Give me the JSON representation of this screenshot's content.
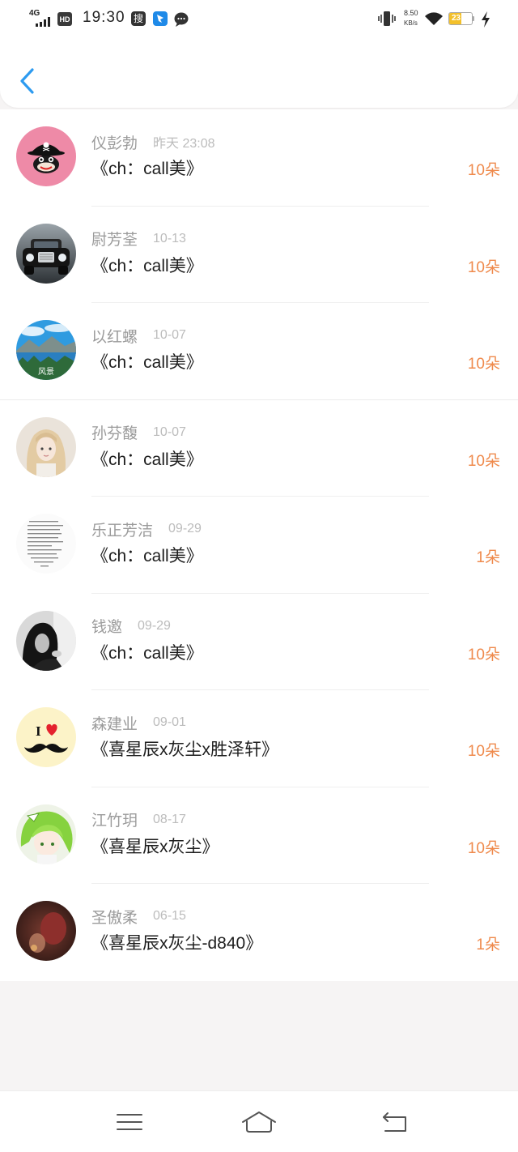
{
  "status_bar": {
    "network_type": "4G",
    "hd_label": "HD",
    "time": "19:30",
    "app_badge_label": "搜",
    "net_speed_value": "8.50",
    "net_speed_unit": "KB/s",
    "battery_level": "23",
    "left_icons": [
      "signal-icon",
      "hd-icon",
      "search-app-icon",
      "blue-app-icon",
      "chat-bubble-icon"
    ],
    "right_icons": [
      "vibrate-icon",
      "wifi-icon",
      "battery-icon",
      "charging-bolt-icon"
    ]
  },
  "header": {
    "back_icon": "chevron-left-icon"
  },
  "theme": {
    "accent": "#2d9bf0",
    "count_color": "#ef8a4c",
    "name_color": "#9b9b9b",
    "time_color": "#bcbcbc",
    "title_color": "#1e1e1e",
    "page_bg": "#f6f4f4"
  },
  "list": {
    "items": [
      {
        "avatar": "pirate-monkey-avatar",
        "name": "仪彭勃",
        "time": "昨天 23:08",
        "title": "《ch：call美》",
        "count": "10朵"
      },
      {
        "avatar": "car-avatar",
        "name": "尉芳荃",
        "time": "10-13",
        "title": "《ch：call美》",
        "count": "10朵"
      },
      {
        "avatar": "landscape-avatar",
        "avatar_text": "风景",
        "name": "以红螺",
        "time": "10-07",
        "title": "《ch：call美》",
        "count": "10朵"
      },
      {
        "avatar": "blonde-girl-avatar",
        "name": "孙芬馥",
        "time": "10-07",
        "title": "《ch：call美》",
        "count": "10朵"
      },
      {
        "avatar": "text-note-avatar",
        "name": "乐正芳洁",
        "time": "09-29",
        "title": "《ch：call美》",
        "count": "1朵"
      },
      {
        "avatar": "bw-girl-avatar",
        "name": "钱邀",
        "time": "09-29",
        "title": "《ch：call美》",
        "count": "10朵"
      },
      {
        "avatar": "mustache-avatar",
        "avatar_text": "I",
        "name": "森建业",
        "time": "09-01",
        "title": "《喜星辰x灰尘x胜泽轩》",
        "count": "10朵"
      },
      {
        "avatar": "green-hair-anime-avatar",
        "name": "江竹玥",
        "time": "08-17",
        "title": "《喜星辰x灰尘》",
        "count": "10朵"
      },
      {
        "avatar": "dark-red-photo-avatar",
        "name": "圣傲柔",
        "time": "06-15",
        "title": "《喜星辰x灰尘-d840》",
        "count": "1朵"
      }
    ]
  },
  "bottom_nav": {
    "icons": [
      "menu-icon",
      "home-icon",
      "return-icon"
    ]
  }
}
